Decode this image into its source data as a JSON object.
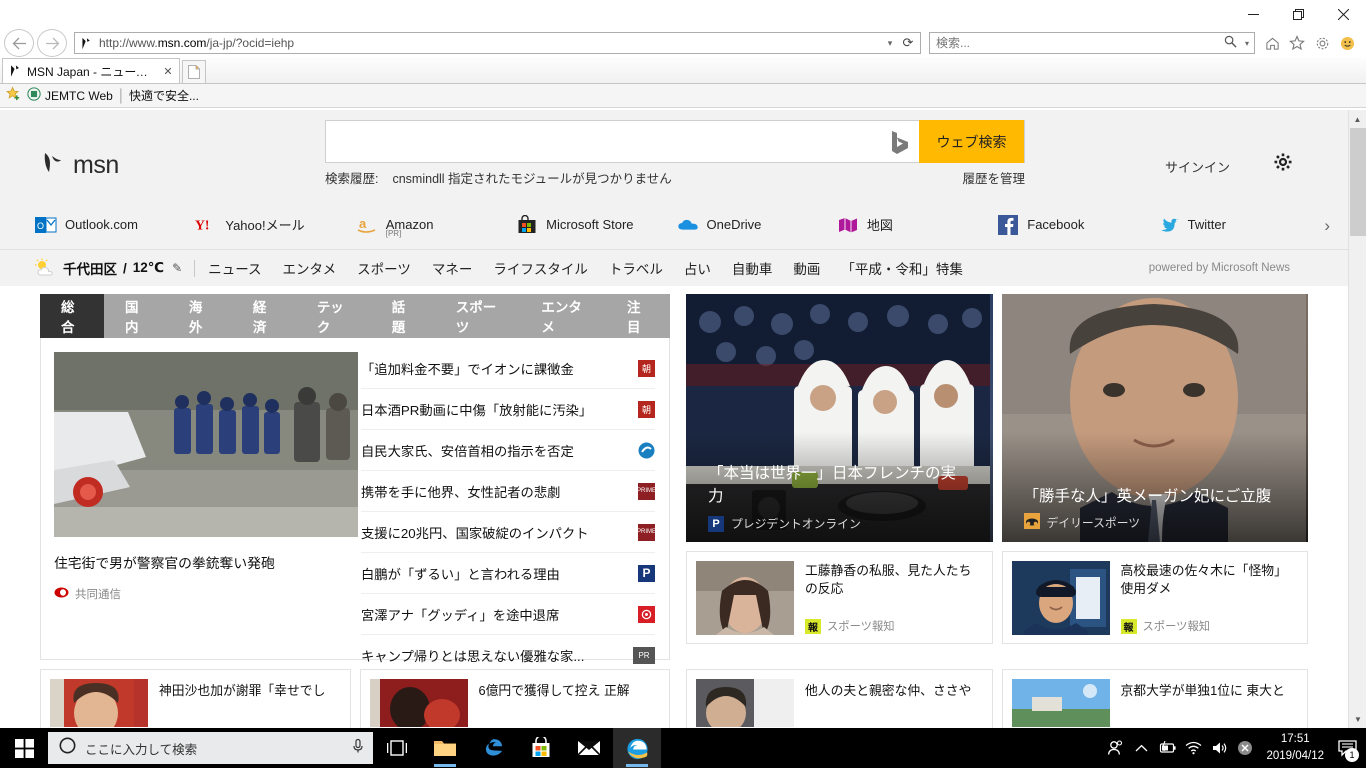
{
  "window": {
    "minimize": "—",
    "restore": "❐",
    "close": "✕"
  },
  "browser": {
    "back_icon": "‹",
    "forward_icon": "›",
    "url_prefix": "http://www.",
    "url_domain": "msn.com",
    "url_suffix": "/ja-jp/?ocid=iehp",
    "url_full": "http://www.msn.com/ja-jp/?ocid=iehp",
    "refresh_icon": "↻",
    "search_placeholder": "検索...",
    "search_value": "",
    "tools": [
      "home-icon",
      "favorites-icon",
      "gear-icon",
      "smiley-icon"
    ],
    "tab": {
      "title": "MSN Japan - ニュース, 天気, ...",
      "close": "✕"
    },
    "favorites": [
      {
        "label": "JEMTC Web"
      },
      {
        "label": "快適で安全..."
      }
    ]
  },
  "msn": {
    "logo": "msn",
    "search_value": "",
    "search_button": "ウェブ検索",
    "history_label": "検索履歴:",
    "history_value": "cnsmindll 指定されたモジュールが見つかりません",
    "history_manage": "履歴を管理",
    "signin": "サインイン",
    "gear": "⚙",
    "quicklinks": [
      {
        "label": "Outlook.com",
        "icon": "outlook-icon",
        "pr": ""
      },
      {
        "label": "Yahoo!メール",
        "icon": "yahoo-icon",
        "pr": ""
      },
      {
        "label": "Amazon",
        "icon": "amazon-icon",
        "pr": "[PR]"
      },
      {
        "label": "Microsoft Store",
        "icon": "microsoft-store-icon",
        "pr": ""
      },
      {
        "label": "OneDrive",
        "icon": "onedrive-icon",
        "pr": ""
      },
      {
        "label": "地図",
        "icon": "maps-icon",
        "pr": ""
      },
      {
        "label": "Facebook",
        "icon": "facebook-icon",
        "pr": ""
      },
      {
        "label": "Twitter",
        "icon": "twitter-icon",
        "pr": ""
      }
    ],
    "quicklinks_next": "›",
    "weather": {
      "location": "千代田区",
      "separator": "/",
      "temperature": "12℃",
      "edit_icon": "✎"
    },
    "nav": [
      "ニュース",
      "エンタメ",
      "スポーツ",
      "マネー",
      "ライフスタイル",
      "トラベル",
      "占い",
      "自動車",
      "動画",
      "「平成・令和」特集"
    ],
    "powered": "powered by Microsoft News"
  },
  "news": {
    "category_tabs": [
      "総合",
      "国内",
      "海外",
      "経済",
      "テック",
      "話題",
      "スポーツ",
      "エンタメ",
      "注目"
    ],
    "active_tab": "総合",
    "lead": {
      "title": "住宅街で男が警察官の拳銃奪い発砲",
      "source": "共同通信"
    },
    "headlines": [
      {
        "text": "「追加料金不要」でイオンに課徴金",
        "badge": "朝",
        "badge_color": "#b5261e"
      },
      {
        "text": "日本酒PR動画に中傷「放射能に汚染」",
        "badge": "朝",
        "badge_color": "#b5261e"
      },
      {
        "text": "自民大家氏、安倍首相の指示を否定",
        "badge": "",
        "badge_color": "#1a7fc1"
      },
      {
        "text": "携帯を手に他界、女性記者の悲劇",
        "badge": "",
        "badge_color": "#8e2024"
      },
      {
        "text": "支援に20兆円、国家破綻のインパクト",
        "badge": "",
        "badge_color": "#8e2024"
      },
      {
        "text": "白鵬が「ずるい」と言われる理由",
        "badge": "P",
        "badge_color": "#16387a"
      },
      {
        "text": "宮澤アナ「グッディ」を途中退席",
        "badge": "",
        "badge_color": "#d81f26"
      },
      {
        "text": "キャンプ帰りとは思えない優雅な家...",
        "badge": "PR",
        "badge_color": "#555555"
      }
    ],
    "heroes": [
      {
        "title": "「本当は世界一」日本フレンチの実力",
        "source": "プレジデントオンライン",
        "badge": "P",
        "badge_color": "#16387a"
      },
      {
        "title": "「勝手な人」英メーガン妃にご立腹",
        "source": "デイリースポーツ",
        "badge": "",
        "badge_color": "#e8a33d"
      }
    ],
    "mini_cards": [
      {
        "title": "工藤静香の私服、見た人たちの反応",
        "source": "スポーツ報知",
        "badge": "報",
        "badge_color": "#d8e82a"
      },
      {
        "title": "高校最速の佐々木に「怪物」使用ダメ",
        "source": "スポーツ報知",
        "badge": "報",
        "badge_color": "#d8e82a"
      }
    ],
    "bottom_cards": [
      {
        "title": "神田沙也加が謝罪「幸せでし"
      },
      {
        "title": "6億円で獲得して控え 正解"
      },
      {
        "title": "他人の夫と親密な仲、ささや"
      },
      {
        "title": "京都大学が単独1位に 東大と"
      }
    ]
  },
  "taskbar": {
    "search_placeholder": "ここに入力して検索",
    "mic_icon": "🎤",
    "buttons": [
      "task-view-icon",
      "file-explorer-icon",
      "edge-icon",
      "microsoft-store-icon",
      "mail-icon",
      "internet-explorer-icon"
    ],
    "tray": {
      "people_icon": "people-icon",
      "chevron_icon": "^",
      "battery_icon": "battery-icon",
      "network_icon": "wifi-icon",
      "volume_icon": "volume-icon",
      "error_icon": "error-icon",
      "time": "17:51",
      "date": "2019/04/12",
      "notification_count": "1"
    }
  },
  "colors": {
    "accent_orange": "#ffb900",
    "tab_active_bg": "#333333",
    "tabs_bg": "#a6a6a6",
    "page_bg": "#f2f2f2",
    "taskbar_bg": "#000000"
  }
}
